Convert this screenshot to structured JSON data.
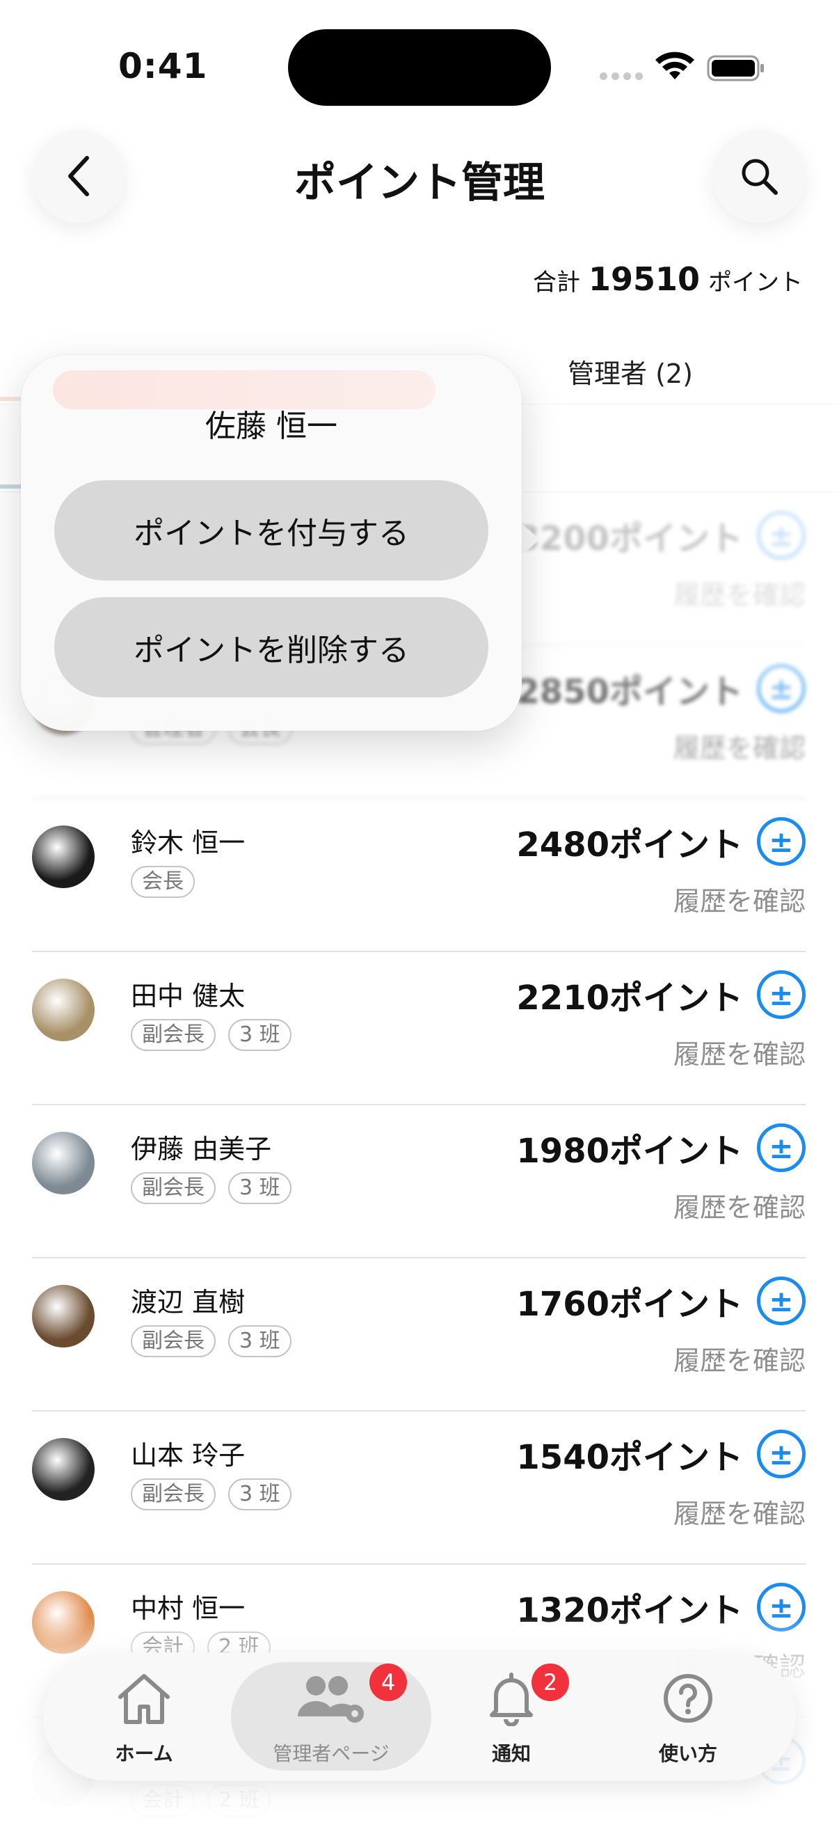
{
  "status_bar": {
    "time": "0:41"
  },
  "header": {
    "title": "ポイント管理"
  },
  "summary": {
    "total_label": "合計",
    "total_value": "19510",
    "unit": "ポイント"
  },
  "tabs": {
    "admin_label": "管理者 (2)"
  },
  "popover": {
    "member_name": "佐藤 恒一",
    "add_label": "ポイントを付与する",
    "remove_label": "ポイントを削除する"
  },
  "members": [
    {
      "name": "",
      "tags": [],
      "points": "3200ポイント",
      "history": "履歴を確認",
      "avatar_color": "#b9a48a"
    },
    {
      "name": "",
      "tags": [
        "管理者",
        "会長"
      ],
      "points": "2850ポイント",
      "history": "履歴を確認",
      "avatar_color": "#8a7d6d"
    },
    {
      "name": "鈴木 恒一",
      "tags": [
        "会長"
      ],
      "points": "2480ポイント",
      "history": "履歴を確認",
      "avatar_color": "#1a1a1a"
    },
    {
      "name": "田中 健太",
      "tags": [
        "副会長",
        "3 班"
      ],
      "points": "2210ポイント",
      "history": "履歴を確認",
      "avatar_color": "#a89168"
    },
    {
      "name": "伊藤 由美子",
      "tags": [
        "副会長",
        "3 班"
      ],
      "points": "1980ポイント",
      "history": "履歴を確認",
      "avatar_color": "#7d8a94"
    },
    {
      "name": "渡辺 直樹",
      "tags": [
        "副会長",
        "3 班"
      ],
      "points": "1760ポイント",
      "history": "履歴を確認",
      "avatar_color": "#6a4b30"
    },
    {
      "name": "山本 玲子",
      "tags": [
        "副会長",
        "3 班"
      ],
      "points": "1540ポイント",
      "history": "履歴を確認",
      "avatar_color": "#222222"
    },
    {
      "name": "中村 恒一",
      "tags": [
        "会計",
        "2 班"
      ],
      "points": "1320ポイント",
      "history": "履歴を確認",
      "avatar_color": "#e08a4a"
    },
    {
      "name": "",
      "tags": [
        "会計",
        "2 班"
      ],
      "points": "",
      "history": "",
      "avatar_color": "#cfcfcf"
    }
  ],
  "bottom_nav": {
    "home": "ホーム",
    "admin": "管理者ページ",
    "admin_badge": "4",
    "notifications": "通知",
    "notifications_badge": "2",
    "help": "使い方"
  },
  "colors": {
    "accent_blue": "#1a8cf0",
    "badge_red": "#f1323d",
    "tab_orange": "#d9532c"
  }
}
